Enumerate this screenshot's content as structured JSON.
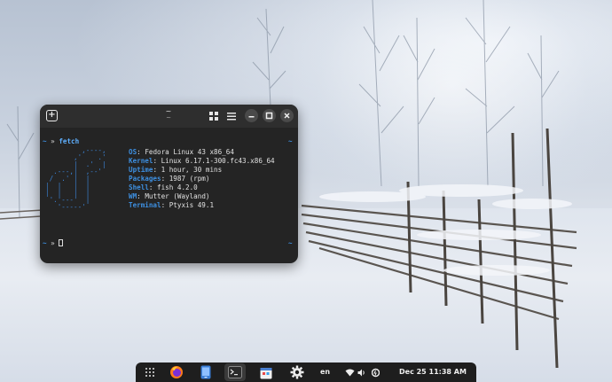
{
  "terminal": {
    "title": "~",
    "subtitle": "~",
    "prompt_symbol": "~",
    "arrow": "»",
    "command": "fetch",
    "right_marker": "~",
    "logo_lines": [
      "         ,----,",
      "       ,'    .'",
      "       |  .'  |",
      "  .---,|  ,--'",
      " /  .' |  |",
      "|  |   |  |",
      "|  |   |  |",
      " '.'---'  |",
      "   '-----'"
    ],
    "info": [
      {
        "key": "OS",
        "value": "Fedora Linux 43 x86_64"
      },
      {
        "key": "Kernel",
        "value": "Linux 6.17.1-300.fc43.x86_64"
      },
      {
        "key": "Uptime",
        "value": "1 hour, 30 mins"
      },
      {
        "key": "Packages",
        "value": "1987 (rpm)"
      },
      {
        "key": "Shell",
        "value": "fish 4.2.0"
      },
      {
        "key": "WM",
        "value": "Mutter (Wayland)"
      },
      {
        "key": "Terminal",
        "value": "Ptyxis 49.1"
      }
    ],
    "separator": ": "
  },
  "taskbar": {
    "language": "en",
    "clock": "Dec 25  11:38 AM",
    "icons": [
      "apps-grid-icon",
      "firefox-icon",
      "phone-icon",
      "terminal-icon",
      "software-store-icon",
      "settings-gear-icon",
      "wifi-icon",
      "volume-icon",
      "battery-icon"
    ]
  },
  "colors": {
    "accent": "#3d8fe0",
    "terminal_bg": "#242424",
    "taskbar_bg": "#1e1e1e"
  }
}
